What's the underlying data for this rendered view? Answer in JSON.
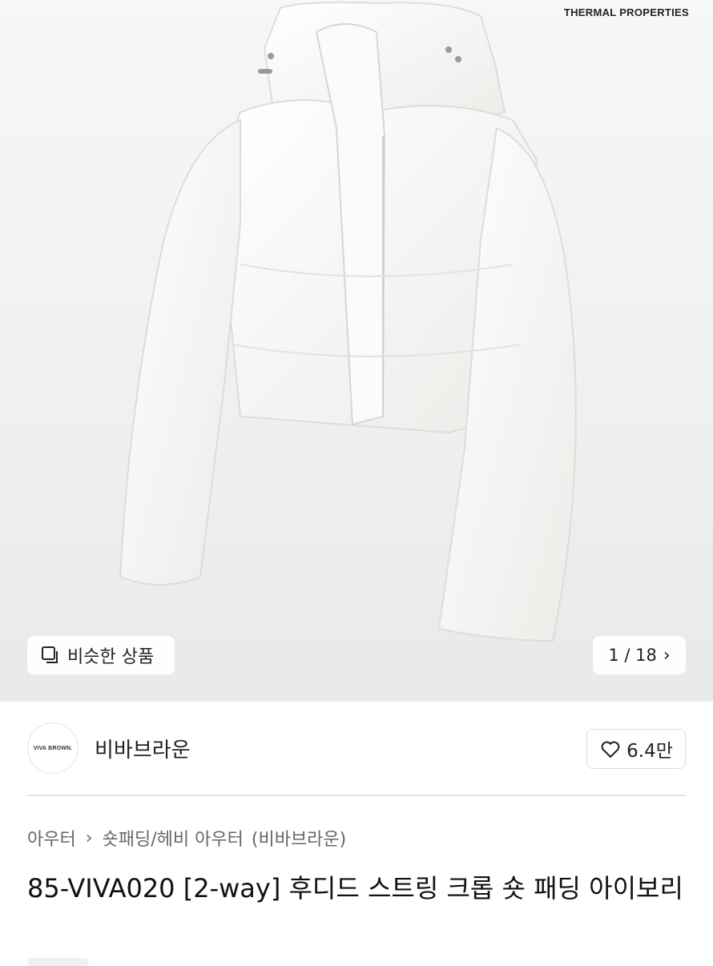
{
  "hero": {
    "overlay_text": "THERMAL PROPERTIES",
    "similar_label": "비슷한 상품",
    "counter_text": "1 / 18",
    "image_alt": "white cropped hooded padded jacket"
  },
  "brand": {
    "logo_text": "VIVA BROWN.",
    "name": "비바브라운",
    "likes": "6.4만"
  },
  "breadcrumb": {
    "category": "아우터",
    "subcategory": "숏패딩/헤비 아우터",
    "brand_suffix": "(비바브라운)"
  },
  "product": {
    "title": "85-VIVA020 [2-way] 후디드 스트링 크롭 숏 패딩 아이보리"
  },
  "colors": {
    "hero_bg": "#f2f2f2",
    "jacket": "#f8f8f6"
  }
}
